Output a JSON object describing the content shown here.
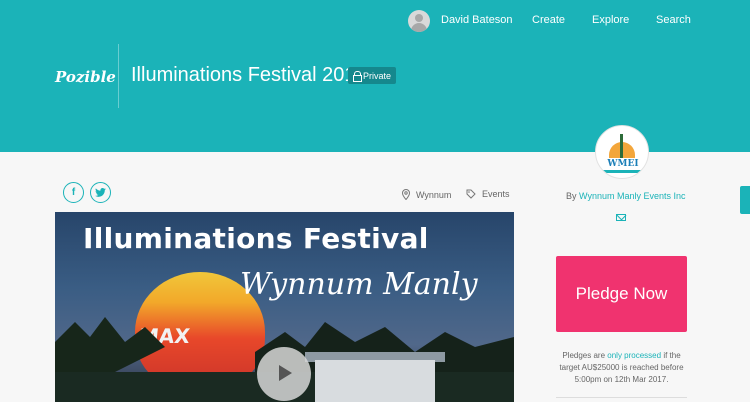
{
  "nav": {
    "user_name": "David Bateson",
    "create": "Create",
    "explore": "Explore",
    "search": "Search"
  },
  "header": {
    "brand": "Pozible",
    "title": "Illuminations Festival 2017",
    "badge": "Private"
  },
  "meta": {
    "location": "Wynnum",
    "category": "Events"
  },
  "social": {
    "facebook": "f",
    "twitter": "t"
  },
  "video": {
    "title": "Illuminations Festival",
    "subtitle": "Wynnum Manly",
    "balloon_text": "MAX"
  },
  "sidebar": {
    "logo_text": "WMEI",
    "by_prefix": "By",
    "creator": "Wynnum Manly Events Inc",
    "pledge_button": "Pledge Now",
    "note_prefix": "Pledges are",
    "note_link": "only processed",
    "note_mid": "if the target AU$25000",
    "note_suffix": "is reached before 5:00pm on 12th Mar 2017."
  },
  "colors": {
    "header_bg": "#1bb3b8",
    "accent": "#1bb3b8",
    "pledge_button": "#f0336f",
    "badge_bg": "#15888d"
  }
}
